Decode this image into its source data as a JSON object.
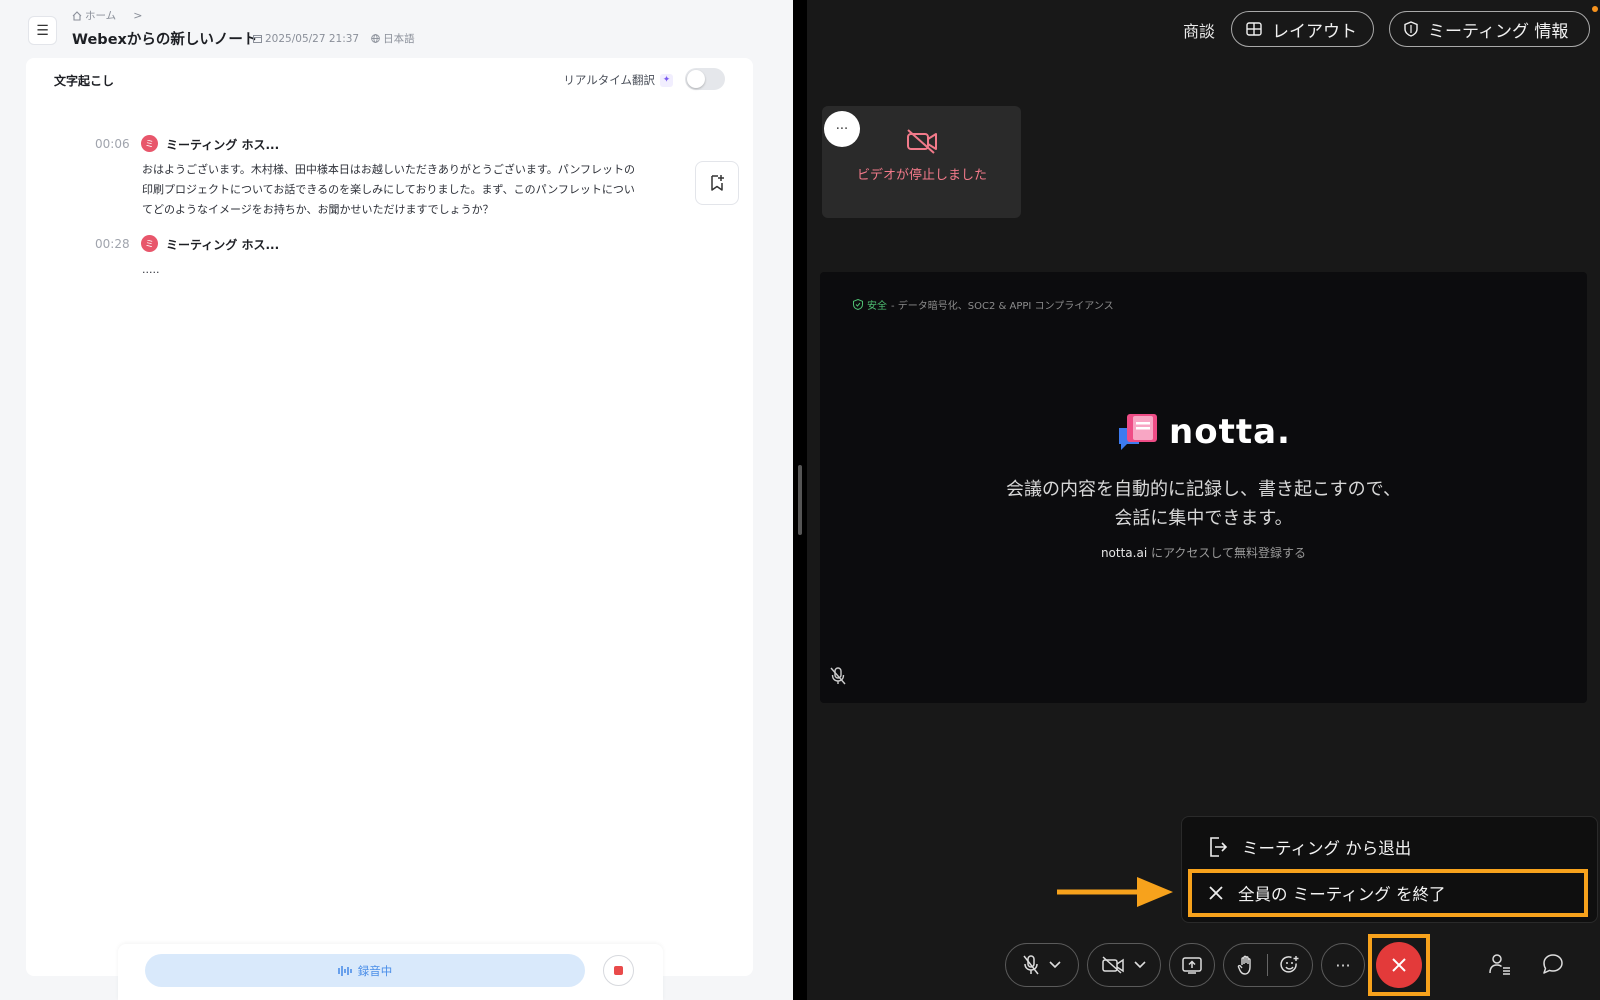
{
  "left": {
    "breadcrumb": {
      "home": "ホーム",
      "separator": ">"
    },
    "title": "Webexからの新しいノート",
    "date": "2025/05/27 21:37",
    "language": "日本語",
    "transcript_tab": "文字起こし",
    "realtime_translation": "リアルタイム翻訳",
    "realtime_translation_on": false,
    "segments": [
      {
        "time": "00:06",
        "avatar": "ミ",
        "speaker": "ミーティング ホス...",
        "text": "おはようございます。木村様、田中様本日はお越しいただきありがとうございます。パンフレットの印刷プロジェクトについてお話できるのを楽しみにしておりました。まず、このパンフレットについてどのようなイメージをお持ちか、お聞かせいただけますでしょうか？"
      },
      {
        "time": "00:28",
        "avatar": "ミ",
        "speaker": "ミーティング ホス...",
        "text": "....."
      }
    ],
    "recording_label": "録音中"
  },
  "right": {
    "toolbar": {
      "meeting_label": "商談",
      "layout_button": "レイアウト",
      "info_button": "ミーティング 情報"
    },
    "self_tile": {
      "more": "···",
      "status": "ビデオが停止しました"
    },
    "stage": {
      "secure_label": "安全",
      "secure_text": " - データ暗号化、SOC2 & APPI コンプライアンス",
      "brand": "notta.",
      "tagline_1": "会議の内容を自動的に記録し、書き起こすので、",
      "tagline_2": "会話に集中できます。",
      "cta_link": "notta.ai",
      "cta_rest": " にアクセスして無料登録する"
    },
    "end_menu": {
      "leave": "ミーティング から退出",
      "end_all": "全員の ミーティング を終了"
    },
    "controls": {
      "more": "···"
    }
  },
  "colors": {
    "accent_orange": "#f7a21c",
    "hangup_red": "#e33a3a",
    "recording_blue": "#4b8ee8",
    "avatar_pink": "#e8566b"
  }
}
